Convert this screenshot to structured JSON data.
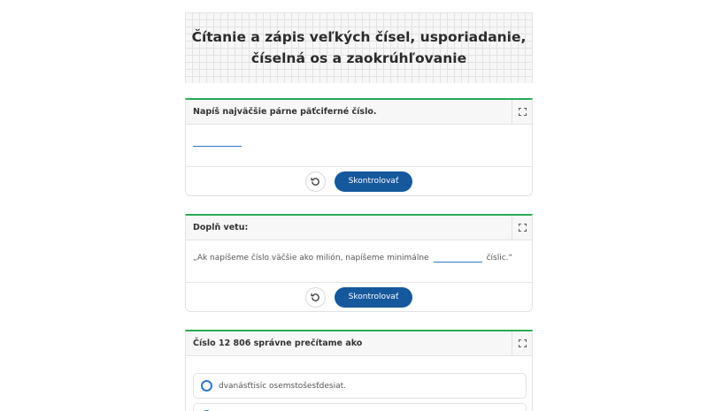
{
  "page": {
    "title": "Čítanie a zápis veľkých čísel, usporiadanie, číselná os a zaokrúhľovanie"
  },
  "exercises": [
    {
      "prompt": "Napíš najväčšie párne päťciferné číslo.",
      "check_label": "Skontrolovať",
      "answer": ""
    },
    {
      "prompt": "Doplň vetu:",
      "sentence_before": "„Ak napíšeme číslo väčšie ako milión, napíšeme minimálne",
      "sentence_after": "číslic.“",
      "check_label": "Skontrolovať",
      "answer": ""
    },
    {
      "prompt": "Číslo 12 806 správne prečítame ako",
      "options": [
        {
          "label": "dvanásťtisíc osemstošesťdesiat."
        },
        {
          "label": ""
        }
      ]
    }
  ],
  "icons": {
    "expand": "expand-icon",
    "reset": "reset-icon"
  },
  "colors": {
    "accent_green": "#2aab55",
    "button_blue": "#15589c",
    "input_blue": "#2f78c4"
  }
}
